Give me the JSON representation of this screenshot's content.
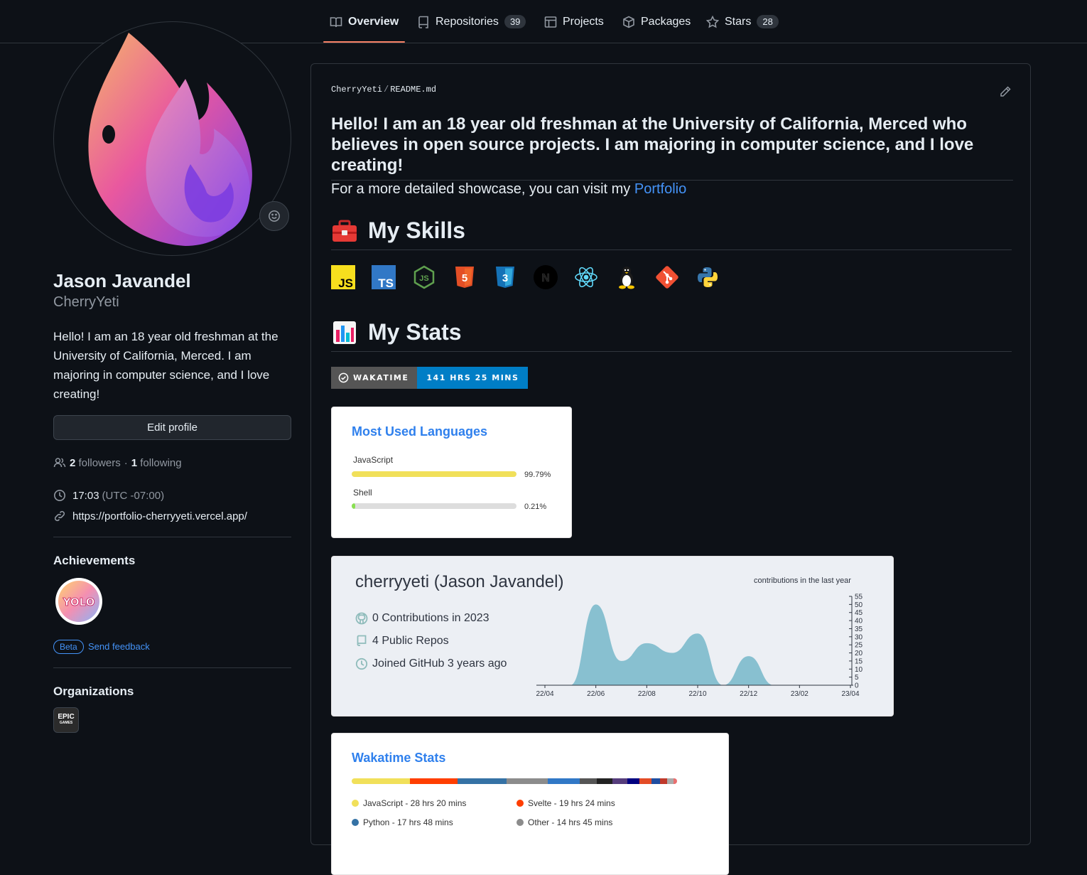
{
  "tabs": [
    {
      "label": "Overview",
      "icon": "book-icon",
      "count": null
    },
    {
      "label": "Repositories",
      "icon": "repo-icon",
      "count": "39"
    },
    {
      "label": "Projects",
      "icon": "table-icon",
      "count": null
    },
    {
      "label": "Packages",
      "icon": "package-icon",
      "count": null
    },
    {
      "label": "Stars",
      "icon": "star-icon",
      "count": "28"
    }
  ],
  "profile": {
    "name": "Jason Javandel",
    "login": "CherryYeti",
    "bio": "Hello! I am an 18 year old freshman at the University of California, Merced. I am majoring in computer science, and I love creating!",
    "edit_label": "Edit profile",
    "followers_count": "2",
    "followers_label": "followers",
    "separator": "·",
    "following_count": "1",
    "following_label": "following",
    "local_time": "17:03",
    "timezone": "(UTC -07:00)",
    "website": "https://portfolio-cherryyeti.vercel.app/",
    "achievements_title": "Achievements",
    "achievement_badge_text": "YOLO",
    "beta_label": "Beta",
    "feedback_label": "Send feedback",
    "organizations_title": "Organizations",
    "org_logo_text": "EPIC",
    "org_logo_subtext": "GAMES"
  },
  "readme": {
    "owner": "CherryYeti",
    "separator": "/",
    "file": "README.md",
    "intro": "Hello! I am an 18 year old freshman at the University of California, Merced who believes in open source projects. I am majoring in computer science, and I love creating!",
    "showcase_text": "For a more detailed showcase, you can visit my",
    "showcase_link": "Portfolio",
    "skills_title": "My Skills",
    "skills": [
      "javascript",
      "typescript",
      "nodejs",
      "html5",
      "css3",
      "nextjs",
      "react",
      "linux",
      "git",
      "python"
    ],
    "skill_badge_js": "JS",
    "skill_badge_ts": "TS",
    "skill_badge_html": "5",
    "skill_badge_css": "3",
    "skill_badge_next": "N",
    "stats_title": "My Stats",
    "wakatime_label": "WAKATIME",
    "wakatime_value": "141 HRS 25 MINS"
  },
  "languages_card": {
    "title": "Most Used Languages",
    "items": [
      {
        "name": "JavaScript",
        "percent": "99.79%",
        "fraction": 0.9979,
        "color": "#f1e05a"
      },
      {
        "name": "Shell",
        "percent": "0.21%",
        "fraction": 0.0021,
        "color": "#89e051"
      }
    ]
  },
  "github_card": {
    "title": "cherryyeti (Jason Javandel)",
    "contributions": "0 Contributions in 2023",
    "repos": "4 Public Repos",
    "joined": "Joined GitHub 3 years ago",
    "chart_label": "contributions in the last year"
  },
  "chart_data": {
    "type": "area",
    "title": "contributions in the last year",
    "x": [
      "22/04",
      "22/05",
      "22/06",
      "22/07",
      "22/08",
      "22/09",
      "22/10",
      "22/11",
      "22/12",
      "23/01",
      "23/02",
      "23/03",
      "23/04"
    ],
    "values": [
      0,
      0,
      50,
      15,
      26,
      20,
      32,
      0,
      18,
      0,
      0,
      0,
      0
    ],
    "xticks": [
      "22/04",
      "22/06",
      "22/08",
      "22/10",
      "22/12",
      "23/02",
      "23/04"
    ],
    "yticks": [
      "55",
      "50",
      "45",
      "40",
      "35",
      "30",
      "25",
      "20",
      "15",
      "10",
      "5",
      "0"
    ],
    "ylim": [
      0,
      55
    ],
    "color": "#88c0d0"
  },
  "wakatime_card": {
    "title": "Wakatime Stats",
    "bar_segments": [
      {
        "color": "#f1e05a",
        "fraction": 0.17
      },
      {
        "color": "#ff3e00",
        "fraction": 0.14
      },
      {
        "color": "#3572a5",
        "fraction": 0.145
      },
      {
        "color": "#8c8c8c",
        "fraction": 0.12
      },
      {
        "color": "#3178c6",
        "fraction": 0.095
      },
      {
        "color": "#555555",
        "fraction": 0.05
      },
      {
        "color": "#222222",
        "fraction": 0.045
      },
      {
        "color": "#563d7c",
        "fraction": 0.045
      },
      {
        "color": "#000080",
        "fraction": 0.035
      },
      {
        "color": "#e34c26",
        "fraction": 0.035
      },
      {
        "color": "#1f4ea1",
        "fraction": 0.025
      },
      {
        "color": "#c0392b",
        "fraction": 0.02
      },
      {
        "color": "#aaaaaa",
        "fraction": 0.02
      },
      {
        "color": "#e96f6f",
        "fraction": 0.01
      }
    ],
    "legend": [
      {
        "label": "JavaScript - 28 hrs 20 mins",
        "color": "#f1e05a"
      },
      {
        "label": "Svelte - 19 hrs 24 mins",
        "color": "#ff3e00"
      },
      {
        "label": "Python - 17 hrs 48 mins",
        "color": "#3572a5"
      },
      {
        "label": "Other - 14 hrs 45 mins",
        "color": "#8c8c8c"
      }
    ]
  }
}
